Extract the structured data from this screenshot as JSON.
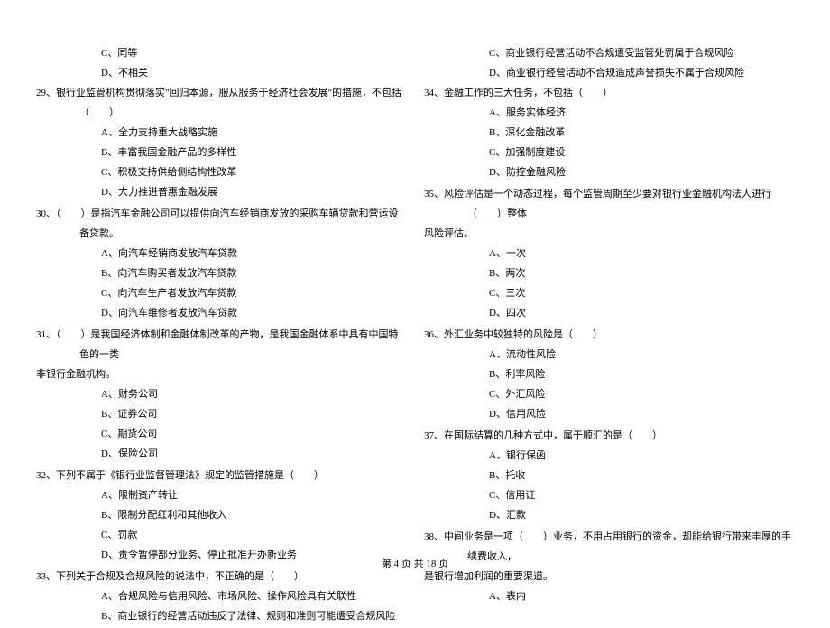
{
  "left_column": {
    "orphan_options": [
      "C、同等",
      "D、不相关"
    ],
    "questions": [
      {
        "number": "29、",
        "text": "银行业监管机构贯彻落实\"回归本源，服从服务于经济社会发展\"的措施，不包括（　　）",
        "options": [
          "A、全力支持重大战略实施",
          "B、丰富我国金融产品的多样性",
          "C、积极支持供给侧结构性改革",
          "D、大力推进普惠金融发展"
        ]
      },
      {
        "number": "30、",
        "text": "（　　）是指汽车金融公司可以提供向汽车经销商发放的采购车辆贷款和营运设备贷款。",
        "options": [
          "A、向汽车经销商发放汽车贷款",
          "B、向汽车购买者发放汽车贷款",
          "C、向汽车生产者发放汽车贷款",
          "D、向汽车维修者发放汽车贷款"
        ]
      },
      {
        "number": "31、",
        "text": "（　　）是我国经济体制和金融体制改革的产物，是我国金融体系中具有中国特色的一类",
        "continuation": "非银行金融机构。",
        "options": [
          "A、财务公司",
          "B、证券公司",
          "C、期货公司",
          "D、保险公司"
        ]
      },
      {
        "number": "32、",
        "text": "下列不属于《银行业监督管理法》规定的监管措施是（　　）",
        "options": [
          "A、限制资产转让",
          "B、限制分配红利和其他收入",
          "C、罚款",
          "D、责令暂停部分业务、停止批准开办新业务"
        ]
      },
      {
        "number": "33、",
        "text": "下列关于合规及合规风险的说法中，不正确的是（　　）",
        "options": [
          "A、合规风险与信用风险、市场风险、操作风险具有关联性",
          "B、商业银行的经营活动违反了法律、规则和准则可能遭受合规风险"
        ]
      }
    ]
  },
  "right_column": {
    "orphan_options": [
      "C、商业银行经营活动不合规遭受监管处罚属于合规风险",
      "D、商业银行经营活动不合规造成声誉损失不属于合规风险"
    ],
    "questions": [
      {
        "number": "34、",
        "text": "金融工作的三大任务，不包括（　　）",
        "options": [
          "A、服务实体经济",
          "B、深化金融改革",
          "C、加强制度建设",
          "D、防控金融风险"
        ]
      },
      {
        "number": "35、",
        "text": "风险评估是一个动态过程，每个监管周期至少要对银行业金融机构法人进行（　　）整体",
        "continuation": "风险评估。",
        "options": [
          "A、一次",
          "B、两次",
          "C、三次",
          "D、四次"
        ]
      },
      {
        "number": "36、",
        "text": "外汇业务中较独特的风险是（　　）",
        "options": [
          "A、流动性风险",
          "B、利率风险",
          "C、外汇风险",
          "D、信用风险"
        ]
      },
      {
        "number": "37、",
        "text": "在国际结算的几种方式中，属于顺汇的是（　　）",
        "options": [
          "A、银行保函",
          "B、托收",
          "C、信用证",
          "D、汇款"
        ]
      },
      {
        "number": "38、",
        "text": "中间业务是一项（　　）业务，不用占用银行的资金，却能给银行带来丰厚的手续费收入，",
        "continuation": "是银行增加利润的重要渠道。",
        "options": [
          "A、表内"
        ]
      }
    ]
  },
  "footer": "第 4 页 共 18 页"
}
